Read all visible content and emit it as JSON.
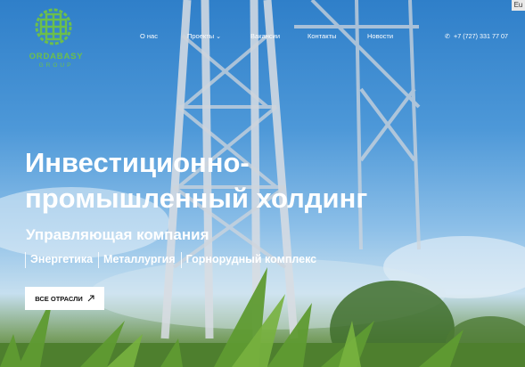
{
  "lang_tab": "Eu",
  "logo": {
    "brand": "ORDABASY",
    "sub": "GROUP"
  },
  "nav": {
    "items": [
      "О нас",
      "Проекты",
      "Вакансии",
      "Контакты",
      "Новости"
    ],
    "projects_chevron": "chevron-down-icon"
  },
  "phone": {
    "icon": "phone-icon",
    "number": "+7 (727) 331 77 07"
  },
  "hero": {
    "title": "Инвестиционно-промышленный холдинг",
    "subtitle": "Управляющая компания",
    "sectors": [
      "Энергетика",
      "Металлургия",
      "Горнорудный комплекс"
    ],
    "cta_label": "ВСЕ ОТРАСЛИ",
    "cta_icon": "arrow-up-right-icon"
  },
  "colors": {
    "brand_green": "#6cbf4b",
    "sky": "#4d98d8",
    "white": "#ffffff"
  }
}
